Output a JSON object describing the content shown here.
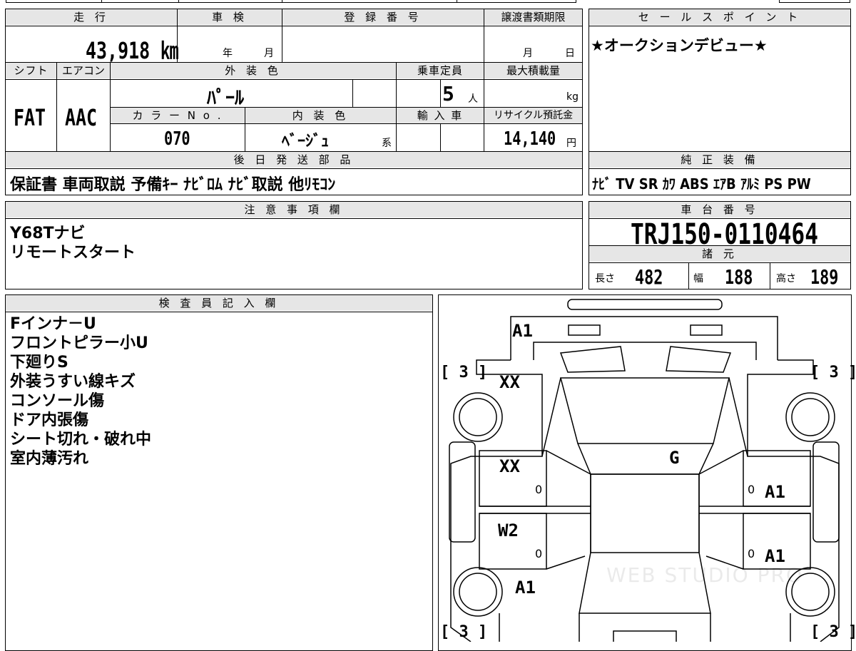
{
  "vehicle_info": {
    "mileage_label": "走 行",
    "mileage_value": "43,918 ㎞",
    "shaken_label": "車 検",
    "shaken_year_unit": "年",
    "shaken_month_unit": "月",
    "reg_number_label": "登 録 番 号",
    "reg_number_value": "",
    "transfer_deadline_label": "譲渡書類期限",
    "transfer_month_unit": "月",
    "transfer_day_unit": "日",
    "shift_label": "シフト",
    "shift_value": "FAT",
    "aircon_label": "エアコン",
    "aircon_value": "AAC",
    "exterior_color_label": "外 装 色",
    "exterior_color_value": "ﾊﾟｰﾙ",
    "capacity_label": "乗車定員",
    "capacity_value": "5",
    "capacity_unit": "人",
    "max_load_label": "最大積載量",
    "max_load_unit": "kg",
    "color_no_label": "カ ラ ー N o .",
    "color_no_value": "070",
    "interior_color_label": "内 装 色",
    "interior_color_value": "ﾍﾞｰｼﾞｭ",
    "interior_color_suffix": "系",
    "import_label": "輸 入 車",
    "recycle_label": "リサイクル預託金",
    "recycle_value": "14,140",
    "recycle_unit": "円"
  },
  "sales_point": {
    "label": "セ ー ル ス ポ イ ン ト",
    "text": "★オークションデビュー★"
  },
  "later_shipment": {
    "label": "後 日 発 送 部 品",
    "items": "保証書 車両取説 予備ｷｰ ﾅﾋﾞﾛﾑ ﾅﾋﾞ取説 他ﾘﾓｺﾝ"
  },
  "factory_equipment": {
    "label": "純 正 装 備",
    "items": "ﾅﾋﾞ TV SR ｶﾜ ABS ｴｱB ｱﾙﾐ PS PW"
  },
  "notes": {
    "label": "注 意 事 項 欄",
    "lines": [
      "Y68Tナビ",
      "リモートスタート"
    ]
  },
  "chassis": {
    "label": "車 台 番 号",
    "value": "TRJ150-0110464"
  },
  "specs": {
    "label": "諸 元",
    "length_label": "長さ",
    "length_value": "482",
    "width_label": "幅",
    "width_value": "188",
    "height_label": "高さ",
    "height_value": "189"
  },
  "inspector": {
    "label": "検 査 員 記 入 欄",
    "lines": [
      "Fインナ－U",
      "フロントピラー小U",
      "下廻りS",
      "外装うすい線キズ",
      "コンソール傷",
      "ドア内張傷",
      "シート切れ・破れ中",
      "室内薄汚れ"
    ]
  },
  "diagram": {
    "tire_tl": "[ 3 ]",
    "tire_tr": "[ 3 ]",
    "tire_bl": "[ 3 ]",
    "tire_br": "[ 3 ]",
    "mark_front": "A1",
    "mark_left_fender": "XX",
    "mark_left_front_door": "XX",
    "mark_left_rear_door": "W2",
    "mark_left_rear": "A1",
    "mark_roof": "G",
    "mark_right_front_door": "A1",
    "mark_right_rear_door": "A1",
    "zero_lf": "0",
    "zero_lr": "0",
    "zero_rf": "0",
    "zero_rr": "0",
    "watermark": "WEB STUDIO PRO"
  }
}
